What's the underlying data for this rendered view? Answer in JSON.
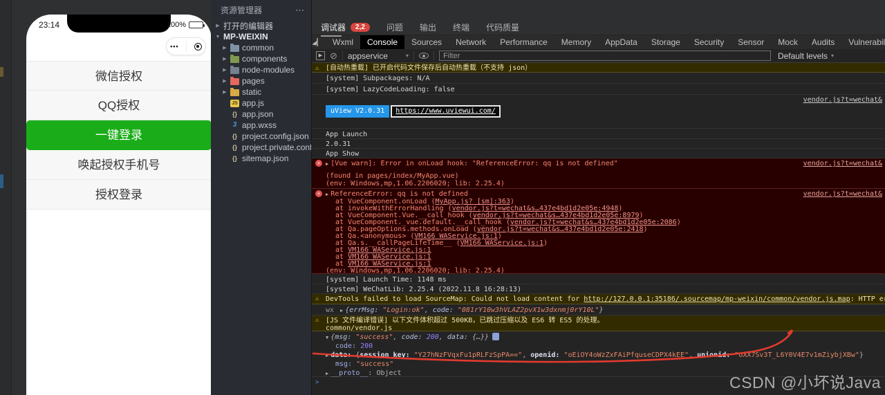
{
  "icons": {
    "warning": "⚠",
    "error": "×",
    "collapsed": "▶",
    "expanded": "▼",
    "menu_dots": "⋯",
    "dropdown": "▾",
    "prompt": ">",
    "capsule_more": "•••",
    "play": "▶",
    "block": "⊘"
  },
  "colors": {
    "wechat_green": "#1aad19",
    "uview_blue": "#2596e8",
    "error_red": "#f48771",
    "annotation_red": "#e23b2e"
  },
  "simulator": {
    "status_time": "23:14",
    "battery_percent": "100%",
    "buttons": [
      {
        "label": "微信授权"
      },
      {
        "label": "QQ授权"
      },
      {
        "label": "一键登录"
      },
      {
        "label": "唤起授权手机号"
      },
      {
        "label": "授权登录"
      }
    ]
  },
  "explorer": {
    "title": "资源管理器",
    "open_editors": "打开的编辑器",
    "root": "MP-WEIXIN",
    "folders": [
      "common",
      "components",
      "node-modules",
      "pages",
      "static"
    ],
    "files": [
      "app.js",
      "app.json",
      "app.wxss",
      "project.config.json",
      "project.private.config.js...",
      "sitemap.json"
    ]
  },
  "panel_tabs": {
    "debugger": "调试器",
    "badge": "2,2",
    "problems": "问题",
    "output": "输出",
    "terminal": "终端",
    "quality": "代码质量"
  },
  "devtools": {
    "tabs": [
      "Wxml",
      "Console",
      "Sources",
      "Network",
      "Performance",
      "Memory",
      "AppData",
      "Storage",
      "Security",
      "Sensor",
      "Mock",
      "Audits",
      "Vulnerability"
    ],
    "toolbar": {
      "context": "appservice",
      "filter_placeholder": "Filter",
      "levels": "Default levels"
    }
  },
  "console": {
    "sep": ", ",
    "hot_reload_warn": "[自动热重载] 已开启代码文件保存后自动热重载（不支持 json）",
    "subpackages": "[system] Subpackages: N/A",
    "lazy_loading": "[system] LazyCodeLoading: false",
    "uview_version": "uView V2.0.31",
    "uview_url": "https://www.uviewui.com/",
    "vendor_link": "vendor.js?t=wechat&",
    "app_launch": "App Launch",
    "version": "2.0.31",
    "app_show": "App Show",
    "vue_warn": "[Vue warn]: Error in onLoad hook: \"ReferenceError: qq is not defined\"",
    "found_in": "(found in pages/index/MyApp.vue)",
    "env": "(env: Windows,mp,1.06.2206020; lib: 2.25.4)",
    "ref_error": "ReferenceError: qq is not defined",
    "stack": [
      {
        "pre": "at VueComponent.onLoad (",
        "link": "MyApp.js? [sm]:363",
        "post": ")"
      },
      {
        "pre": "at invokeWithErrorHandling (",
        "link": "vendor.js?t=wechat&s…437e4bd1d2e05e:4948",
        "post": ")"
      },
      {
        "pre": "at VueComponent.Vue.__call_hook (",
        "link": "vendor.js?t=wechat&s…437e4bd1d2e05e:8979",
        "post": ")"
      },
      {
        "pre": "at VueComponent._vue.default.__call_hook (",
        "link": "vendor.js?t=wechat&s…437e4bd1d2e05e:2086",
        "post": ")"
      },
      {
        "pre": "at Qa.pageOptions.methods.onLoad (",
        "link": "vendor.js?t=wechat&s…437e4bd1d2e05e:2418",
        "post": ")"
      },
      {
        "pre": "at Qa.<anonymous> (",
        "link": "VM166 WAService.js:1",
        "post": ")"
      },
      {
        "pre": "at Qa.s.__callPageLifeTime__ (",
        "link": "VM166 WAService.js:1",
        "post": ")"
      },
      {
        "pre": "at ",
        "link": "VM166 WAService.js:1",
        "post": ""
      },
      {
        "pre": "at ",
        "link": "VM166 WAService.js:1",
        "post": ""
      },
      {
        "pre": "at ",
        "link": "VM166 WAService.js:1",
        "post": ""
      }
    ],
    "launch_time": "[system] Launch Time: 1148 ms",
    "wechat_lib": "[system] WeChatLib: 2.25.4 (2022.11.8 16:28:13)",
    "sourcemap": {
      "pre": "DevTools failed to load SourceMap: Could not load content for ",
      "link": "http://127.0.0.1:35186/.sourcemap/mp-weixin/common/vendor.js.map",
      "post": ": HTTP error: status code 403, net::ERR_HTTP_RE"
    },
    "wx": {
      "label": "wx",
      "open": "{",
      "close": "}",
      "k1": "errMsg: ",
      "v1": "\"Login:ok\"",
      "k2": "code: ",
      "v2": "\"081rY10w3hVLAZ2pvX1w3dxnmj0rY10L\""
    },
    "js_size_warn": "[JS 文件编译错误] 以下文件体积超过 500KB，已跳过压缩以及 ES6 转 ES5 的处理。",
    "js_size_file": "common/vendor.js",
    "result": {
      "open": "{",
      "close": "}",
      "pk1": "msg: ",
      "pv1": "\"success\"",
      "pk2": "code: ",
      "pv2": "200",
      "pk3": "data: ",
      "pv3": "{…}",
      "code_key": "code: ",
      "code_val": "200",
      "data_key": "data: ",
      "dk1": "session_key: ",
      "dv1": "\"Y27hNzFVqxFu1pRLFzSpPA==\"",
      "dk2": "openid: ",
      "dv2": "\"oEiOY4oWzZxFAiPfquseCDPX4kEE\"",
      "dk3": "unionid: ",
      "dv3": "\"oXX7Sv3T_L6Y0V4E7v1mZiybjXBw\"",
      "msg_key": "msg: ",
      "msg_val": "\"success\"",
      "proto_key": "__proto__: ",
      "proto_val": "Object"
    }
  },
  "watermark": "CSDN @小坏说Java"
}
